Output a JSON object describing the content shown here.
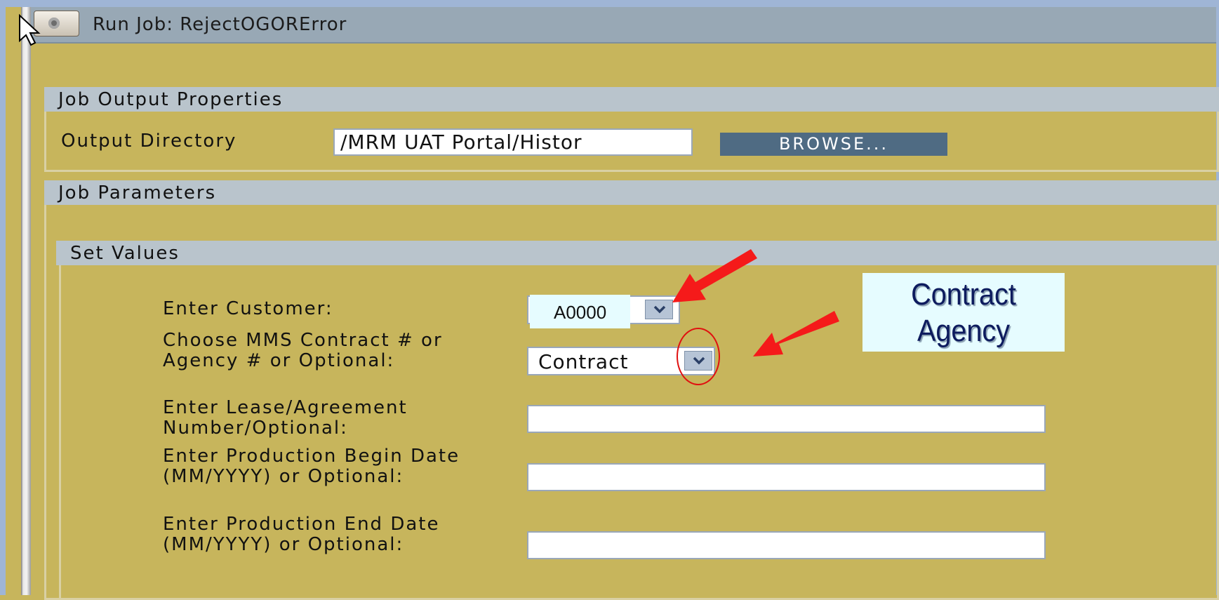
{
  "window": {
    "title": "Run Job: RejectOGORError"
  },
  "output_section": {
    "header": "Job Output Properties",
    "directory_label": "Output Directory",
    "directory_value": "/MRM UAT Portal/Histor",
    "browse_label": "BROWSE..."
  },
  "parameters_section": {
    "header": "Job Parameters",
    "set_values_header": "Set Values",
    "fields": [
      {
        "label": "Enter Customer:",
        "value": "A0000"
      },
      {
        "label": "Choose MMS Contract # or Agency # or Optional:",
        "value": "Contract"
      },
      {
        "label": "Enter Lease/Agreement Number/Optional:",
        "value": ""
      },
      {
        "label": "Enter Production Begin Date (MM/YYYY) or Optional:",
        "value": ""
      },
      {
        "label": "Enter Production End Date (MM/YYYY) or Optional:",
        "value": ""
      }
    ]
  },
  "annotation": {
    "callout_line1": "Contract",
    "callout_line2": "Agency",
    "arrow_color": "#f51a1a",
    "circle_color": "#e01010"
  },
  "icons": {
    "title_icon": "gear-icon",
    "dropdown_icon": "chevron-down-icon",
    "cursor_icon": "mouse-pointer-icon"
  }
}
